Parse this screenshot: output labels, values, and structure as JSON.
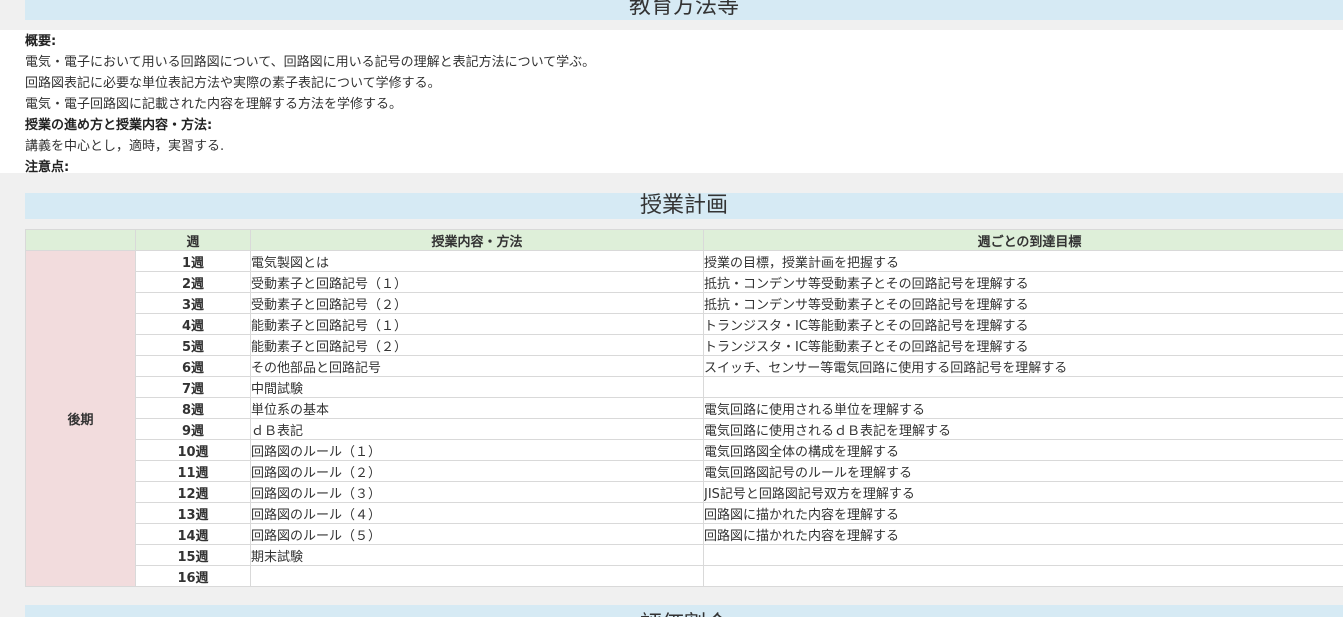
{
  "method_section": {
    "title": "教育方法等"
  },
  "overview": {
    "summary_label": "概要:",
    "summary_lines": [
      "電気・電子において用いる回路図について、回路図に用いる記号の理解と表記方法について学ぶ。",
      "回路図表記に必要な単位表記方法や実際の素子表記について学修する。",
      "電気・電子回路図に記載された内容を理解する方法を学修する。"
    ],
    "progress_label": "授業の進め方と授業内容・方法:",
    "progress_text": "講義を中心とし，適時，実習する.",
    "notes_label": "注意点:"
  },
  "plan_section": {
    "title": "授業計画"
  },
  "plan_table": {
    "headers": {
      "term": "",
      "week": "週",
      "content": "授業内容・方法",
      "goal": "週ごとの到達目標"
    },
    "term_label": "後期",
    "rows": [
      {
        "week": "1週",
        "content": "電気製図とは",
        "goal": "授業の目標，授業計画を把握する"
      },
      {
        "week": "2週",
        "content": "受動素子と回路記号（１）",
        "goal": "抵抗・コンデンサ等受動素子とその回路記号を理解する"
      },
      {
        "week": "3週",
        "content": "受動素子と回路記号（２）",
        "goal": "抵抗・コンデンサ等受動素子とその回路記号を理解する"
      },
      {
        "week": "4週",
        "content": "能動素子と回路記号（１）",
        "goal": "トランジスタ・IC等能動素子とその回路記号を理解する"
      },
      {
        "week": "5週",
        "content": "能動素子と回路記号（２）",
        "goal": "トランジスタ・IC等能動素子とその回路記号を理解する"
      },
      {
        "week": "6週",
        "content": "その他部品と回路記号",
        "goal": "スイッチ、センサー等電気回路に使用する回路記号を理解する"
      },
      {
        "week": "7週",
        "content": "中間試験",
        "goal": ""
      },
      {
        "week": "8週",
        "content": "単位系の基本",
        "goal": "電気回路に使用される単位を理解する"
      },
      {
        "week": "9週",
        "content": "ｄＢ表記",
        "goal": "電気回路に使用されるｄＢ表記を理解する"
      },
      {
        "week": "10週",
        "content": "回路図のルール（１）",
        "goal": "電気回路図全体の構成を理解する"
      },
      {
        "week": "11週",
        "content": "回路図のルール（２）",
        "goal": "電気回路図記号のルールを理解する"
      },
      {
        "week": "12週",
        "content": "回路図のルール（３）",
        "goal": "JIS記号と回路図記号双方を理解する"
      },
      {
        "week": "13週",
        "content": "回路図のルール（４）",
        "goal": "回路図に描かれた内容を理解する"
      },
      {
        "week": "14週",
        "content": "回路図のルール（５）",
        "goal": "回路図に描かれた内容を理解する"
      },
      {
        "week": "15週",
        "content": "期末試験",
        "goal": ""
      },
      {
        "week": "16週",
        "content": "",
        "goal": ""
      }
    ]
  },
  "eval_section": {
    "title": "評価割合"
  }
}
